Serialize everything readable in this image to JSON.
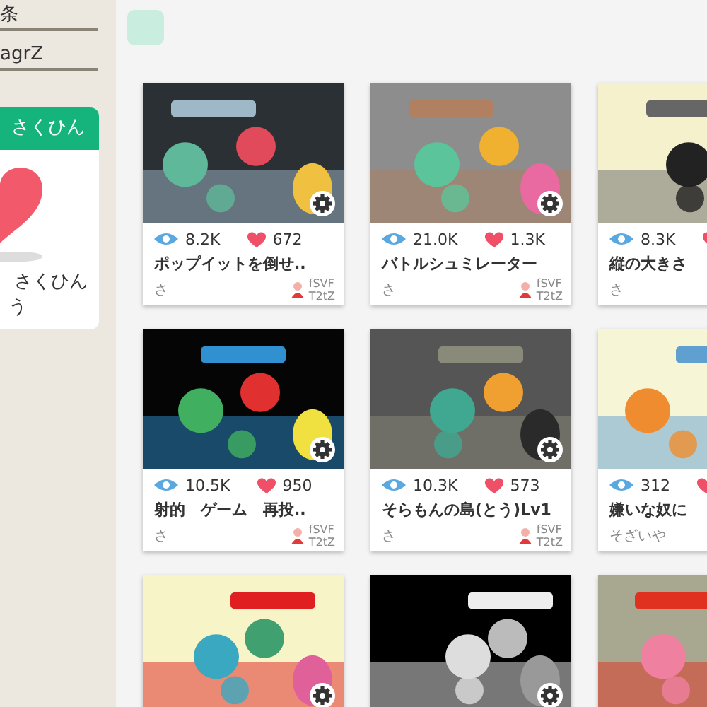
{
  "sidebar": {
    "fields": [
      {
        "value": "条"
      },
      {
        "value": "agrZ"
      }
    ],
    "card": {
      "header": "さくひん",
      "lines": [
        "さくひん",
        "う"
      ]
    }
  },
  "games": [
    {
      "kind": "card",
      "views": "8.2K",
      "likes": "672",
      "title": "ポップイットを倒せ..",
      "author": "さ",
      "creator": [
        "fSVF",
        "T2tZ"
      ]
    },
    {
      "kind": "card",
      "views": "21.0K",
      "likes": "1.3K",
      "title": "バトルシュミレーター",
      "author": "さ",
      "creator": [
        "fSVF",
        "T2tZ"
      ]
    },
    {
      "kind": "card",
      "views": "8.3K",
      "title": "縦の大きさ",
      "author": "さ"
    },
    {
      "kind": "card",
      "views": "10.5K",
      "likes": "950",
      "title": "射的　ゲーム　再投..",
      "author": "さ",
      "creator": [
        "fSVF",
        "T2tZ"
      ]
    },
    {
      "kind": "card",
      "views": "10.3K",
      "likes": "573",
      "title": "そらもんの島(とう)Lv1",
      "author": "さ",
      "creator": [
        "fSVF",
        "T2tZ"
      ]
    },
    {
      "kind": "card",
      "views": "312",
      "title": "嫌いな奴に",
      "author": "そざいや"
    },
    {
      "kind": "picture"
    },
    {
      "kind": "picture"
    },
    {
      "kind": "picture"
    }
  ]
}
